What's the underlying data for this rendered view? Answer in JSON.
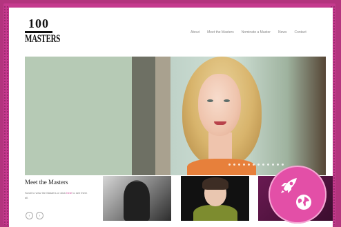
{
  "site": {
    "logo_number": "100",
    "logo_word": "MASTERS"
  },
  "nav": {
    "items": [
      {
        "label": "About"
      },
      {
        "label": "Meet the Masters"
      },
      {
        "label": "Nominate a Master"
      },
      {
        "label": "News"
      },
      {
        "label": "Contact"
      }
    ]
  },
  "section": {
    "title": "Meet the Masters",
    "desc_before": "Scroll to view the Masters or click",
    "link_text": "here",
    "desc_after": "to see them all."
  },
  "colors": {
    "accent": "#c53a8e",
    "badge": "#e34fa7",
    "frame": "#b3347e"
  },
  "icons": {
    "prev": "chevron-left-icon",
    "next": "chevron-right-icon",
    "badge_rocket": "rocket-icon",
    "badge_globe": "globe-icon"
  }
}
